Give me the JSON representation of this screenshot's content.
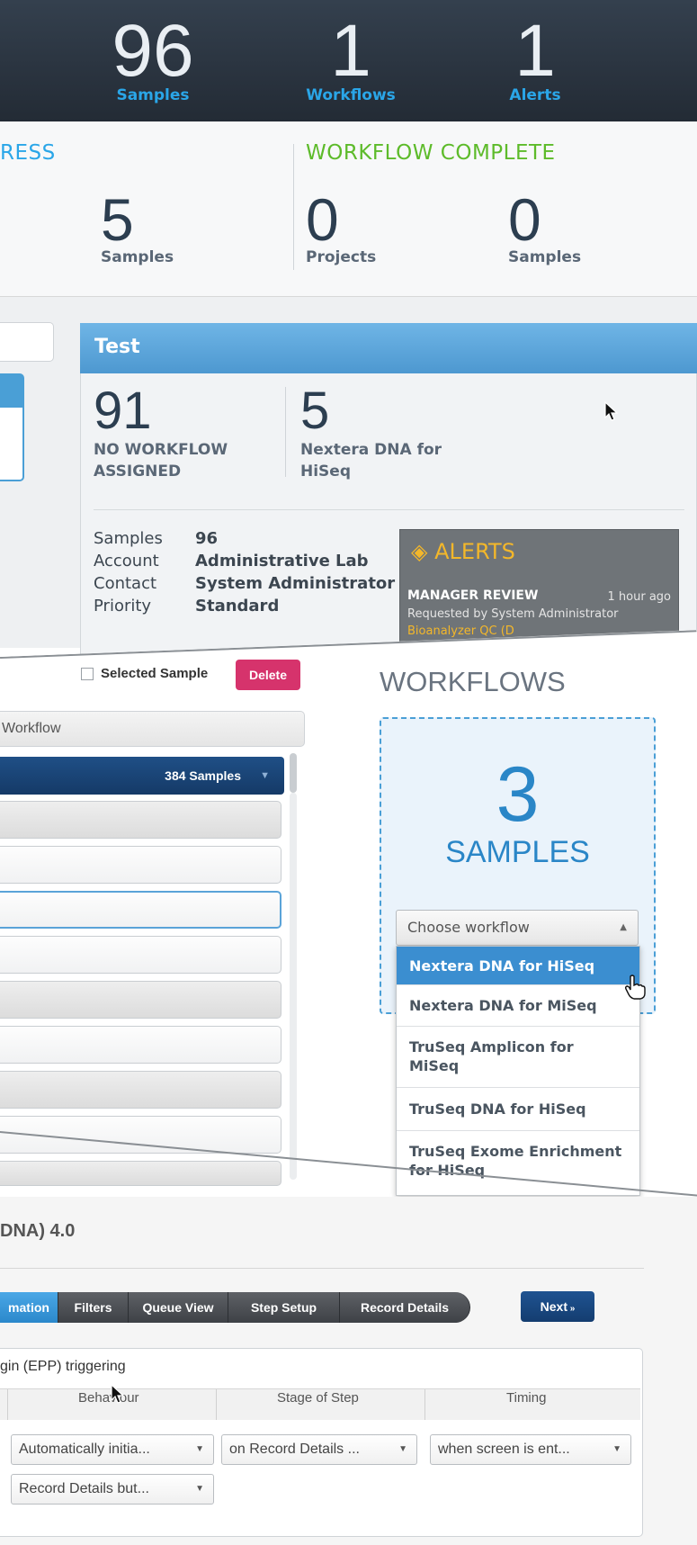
{
  "top_stats": [
    {
      "number": "96",
      "label": "Samples"
    },
    {
      "number": "1",
      "label": "Workflows"
    },
    {
      "number": "1",
      "label": "Alerts"
    }
  ],
  "summary": {
    "in_progress_title": "RESS",
    "in_progress_number": "5",
    "in_progress_label": "Samples",
    "complete_title": "WORKFLOW COMPLETE",
    "complete_projects_number": "0",
    "complete_projects_label": "Projects",
    "complete_samples_number": "0",
    "complete_samples_label": "Samples"
  },
  "project": {
    "title": "Test",
    "no_workflow_count": "91",
    "no_workflow_label_1": "NO WORKFLOW",
    "no_workflow_label_2": "ASSIGNED",
    "workflow_count": "5",
    "workflow_label_1": "Nextera DNA for",
    "workflow_label_2": "HiSeq",
    "details": {
      "samples_key": "Samples",
      "samples_val": "96",
      "account_key": "Account",
      "account_val": "Administrative Lab",
      "contact_key": "Contact",
      "contact_val": "System Administrator",
      "priority_key": "Priority",
      "priority_val": "Standard"
    },
    "alerts": {
      "title": "ALERTS",
      "item_title": "MANAGER REVIEW",
      "item_time": "1 hour ago",
      "item_requested": "Requested by System Administrator",
      "item_link": "Bioanalyzer QC (D"
    }
  },
  "sample_panel": {
    "selected_text": "Selected Sample",
    "delete_label": "Delete",
    "workflow_header": "Workflow",
    "group_count": "384 Samples"
  },
  "workflows_panel": {
    "title": "WORKFLOWS",
    "count": "3",
    "count_label": "SAMPLES",
    "dropdown_placeholder": "Choose workflow",
    "options": [
      "Nextera DNA for HiSeq",
      "Nextera DNA for MiSeq",
      "TruSeq Amplicon for MiSeq",
      "TruSeq DNA for HiSeq",
      "TruSeq Exome Enrichment for HiSeq"
    ]
  },
  "config": {
    "title": "DNA) 4.0",
    "tabs": [
      "mation",
      "Filters",
      "Queue View",
      "Step Setup",
      "Record Details"
    ],
    "next_label": "Next",
    "section_title": "gin (EPP) triggering",
    "headers": [
      "Behaviour",
      "Stage of Step",
      "Timing"
    ],
    "row1": [
      "Automatically initia...",
      "on Record Details ...",
      "when screen is ent..."
    ],
    "row2": [
      "Record Details but..."
    ]
  },
  "colors": {
    "accent_blue": "#2aa6e8",
    "complete_green": "#5dbb2a",
    "delete_red": "#d6336c",
    "alert_yellow": "#f3b72a"
  }
}
